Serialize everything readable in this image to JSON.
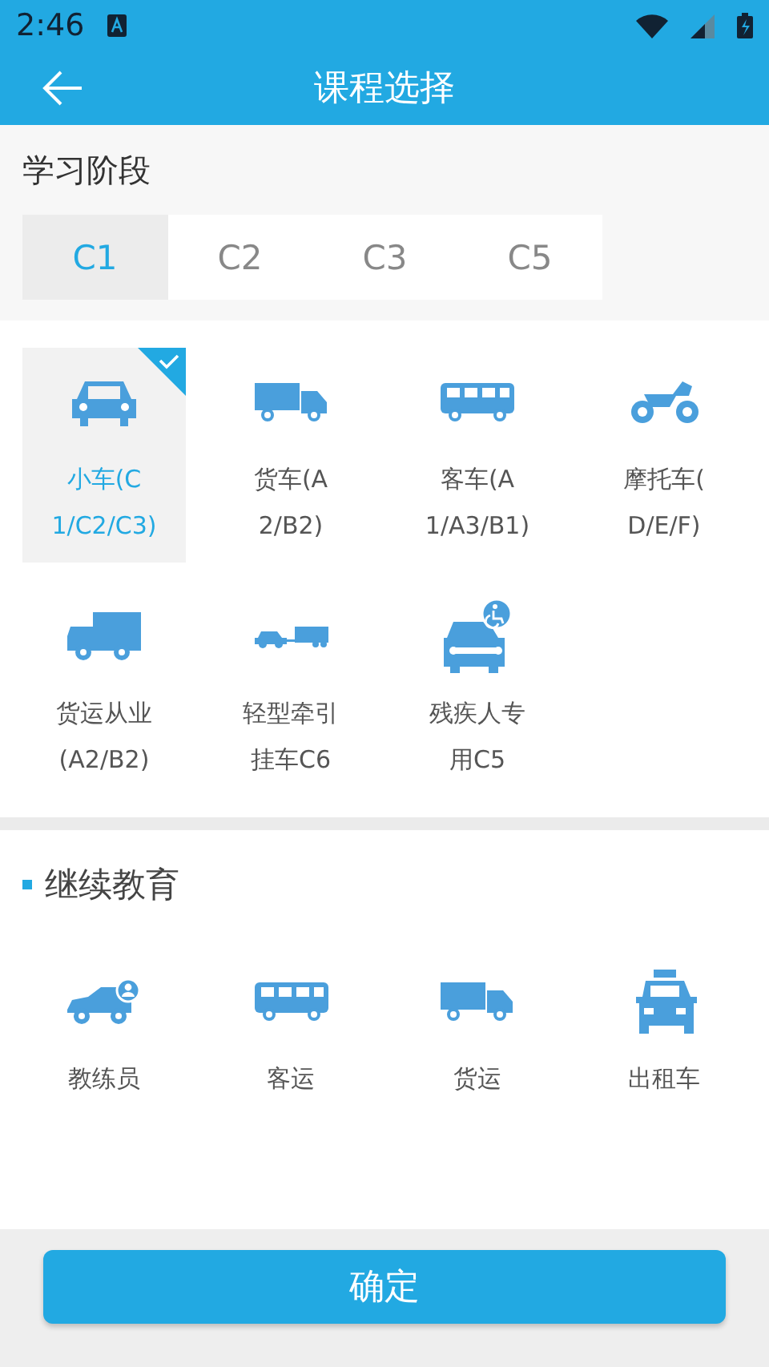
{
  "status_bar": {
    "time": "2:46"
  },
  "header": {
    "title": "课程选择"
  },
  "stage": {
    "title": "学习阶段",
    "tabs": [
      {
        "label": "C1",
        "selected": true
      },
      {
        "label": "C2",
        "selected": false
      },
      {
        "label": "C3",
        "selected": false
      },
      {
        "label": "C5",
        "selected": false
      }
    ]
  },
  "vehicles": [
    {
      "kind": "car",
      "lines": [
        "小车(C",
        "1/C2/C3)"
      ],
      "selected": true
    },
    {
      "kind": "truck",
      "lines": [
        "货车(A",
        "2/B2)"
      ],
      "selected": false
    },
    {
      "kind": "bus",
      "lines": [
        "客车(A",
        "1/A3/B1)"
      ],
      "selected": false
    },
    {
      "kind": "motorcycle",
      "lines": [
        "摩托车(",
        "D/E/F)"
      ],
      "selected": false
    },
    {
      "kind": "van",
      "lines": [
        "货运从业",
        "(A2/B2)"
      ],
      "selected": false
    },
    {
      "kind": "trailer",
      "lines": [
        "轻型牵引",
        "挂车C6"
      ],
      "selected": false
    },
    {
      "kind": "accessible",
      "lines": [
        "残疾人专",
        "用C5"
      ],
      "selected": false
    }
  ],
  "continuing": {
    "title": "继续教育",
    "items": [
      {
        "kind": "instructor",
        "label": "教练员"
      },
      {
        "kind": "bus",
        "label": "客运"
      },
      {
        "kind": "truck",
        "label": "货运"
      },
      {
        "kind": "taxi",
        "label": "出租车"
      }
    ]
  },
  "confirm": {
    "label": "确定"
  }
}
